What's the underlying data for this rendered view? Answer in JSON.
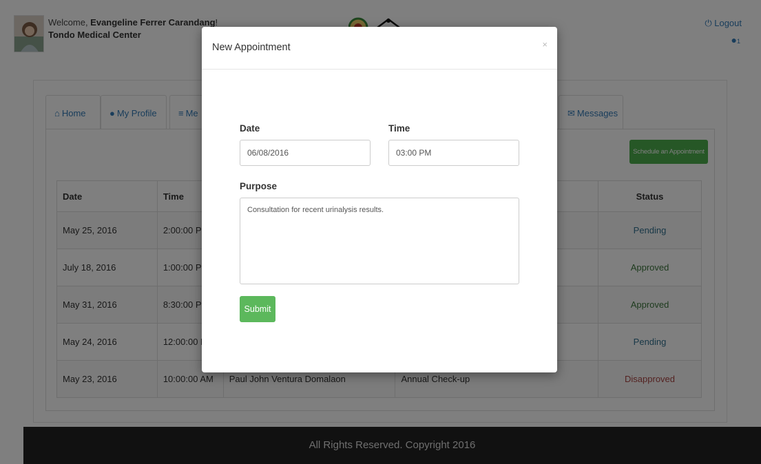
{
  "header": {
    "welcome_prefix": "Welcome, ",
    "user_name": "Evangeline Ferrer Carandang",
    "welcome_suffix": "!",
    "facility": "Tondo Medical Center",
    "logout_label": "Logout",
    "notification_count": "1"
  },
  "tabs": [
    {
      "label": "Home",
      "icon": "home-icon"
    },
    {
      "label": "My Profile",
      "icon": "user-icon"
    },
    {
      "label": "Me",
      "icon": "list-icon"
    },
    {
      "label": "Messages",
      "icon": "envelope-icon"
    }
  ],
  "schedule_button": "Schedule an Appointment",
  "table": {
    "headers": {
      "date": "Date",
      "time": "Time",
      "status": "Status"
    },
    "rows": [
      {
        "date": "May 25, 2016",
        "time": "2:00:00 PM",
        "doctor": "",
        "purpose": "",
        "status": "Pending",
        "status_type": "pending"
      },
      {
        "date": "July 18, 2016",
        "time": "1:00:00 PM",
        "doctor": "",
        "purpose": "",
        "status": "Approved",
        "status_type": "approved"
      },
      {
        "date": "May 31, 2016",
        "time": "8:30:00 PM",
        "doctor": "",
        "purpose": "",
        "status": "Approved",
        "status_type": "approved"
      },
      {
        "date": "May 24, 2016",
        "time": "12:00:00 PM",
        "doctor": "",
        "purpose": "",
        "status": "Pending",
        "status_type": "pending"
      },
      {
        "date": "May 23, 2016",
        "time": "10:00:00 AM",
        "doctor": "Paul John Ventura Domalaon",
        "purpose": "Annual Check-up",
        "status": "Disapproved",
        "status_type": "disapproved"
      }
    ]
  },
  "footer": "All Rights Reserved. Copyright 2016",
  "modal": {
    "title": "New Appointment",
    "close": "×",
    "date_label": "Date",
    "date_value": "06/08/2016",
    "time_label": "Time",
    "time_value": "03:00 PM",
    "purpose_label": "Purpose",
    "purpose_value": "Consultation for recent urinalysis results.",
    "submit_label": "Submit"
  },
  "colors": {
    "primary_link": "#337ab7",
    "success": "#5cb85c",
    "pending": "#31708f",
    "approved": "#3c763d",
    "disapproved": "#a94442",
    "footer_bg": "#222222"
  }
}
